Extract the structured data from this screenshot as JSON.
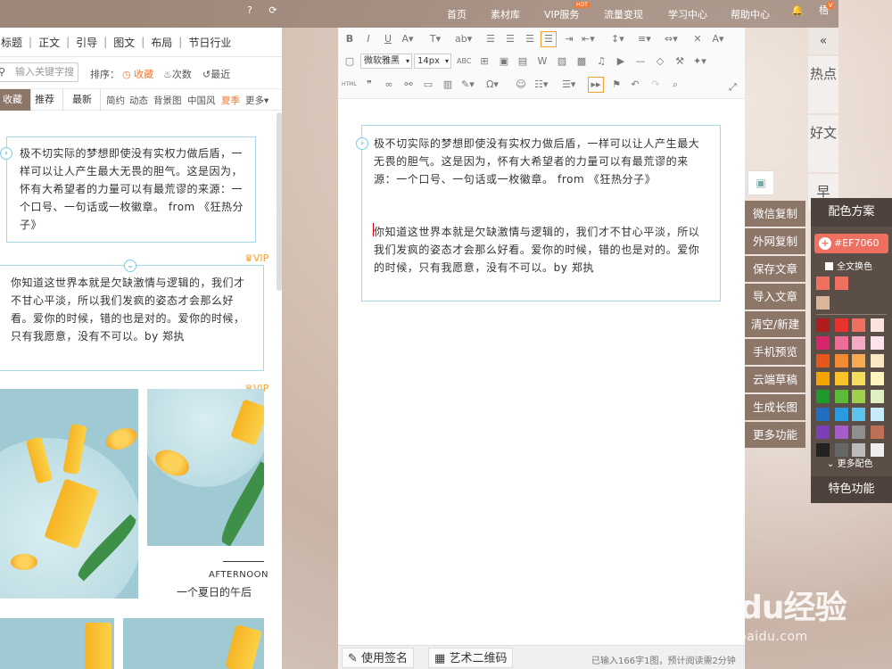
{
  "topnav": {
    "items": [
      "首页",
      "素材库",
      "VIP服务",
      "流量变现",
      "学习中心",
      "帮助中心"
    ],
    "hot_badge": "HOT",
    "user_label": "梧",
    "user_badge": "V"
  },
  "left": {
    "cat_tabs": [
      "标题",
      "正文",
      "引导",
      "图文",
      "布局",
      "节日行业"
    ],
    "search_placeholder": "输入关键字搜",
    "sort_label": "排序：",
    "sort_fav": "收藏",
    "sort_count": "次数",
    "sort_recent": "最近",
    "filter_tabs": [
      "收藏",
      "推荐",
      "最新"
    ],
    "filter_tags": [
      "简约",
      "动态",
      "背景图",
      "中国风",
      "夏季",
      "更多"
    ],
    "tpl1_text": "极不切实际的梦想即使没有实权力做后盾，一样可以让人产生最大无畏的胆气。这是因为，怀有大希望者的力量可以有最荒谬的来源：一个口号、一句话或一枚徽章。 from 《狂热分子》",
    "tpl2_text": "你知道这世界本就是欠缺激情与逻辑的，我们才不甘心平淡，所以我们发疯的姿态才会那么好看。爱你的时候，错的也是对的。爱你的时候，只有我愿意，没有不可以。by 郑执",
    "vip_label": "VIP",
    "photo_caption_en": "AFTERNOON",
    "photo_caption_cn": "一个夏日的午后"
  },
  "editor": {
    "font_family": "微软雅黑",
    "font_size": "14px",
    "para1": "极不切实际的梦想即使没有实权力做后盾，一样可以让人产生最大无畏的胆气。这是因为，怀有大希望者的力量可以有最荒谬的来源：一个口号、一句话或一枚徽章。 from 《狂热分子》",
    "para2": "你知道这世界本就是欠缺激情与逻辑的，我们才不甘心平淡，所以我们发疯的姿态才会那么好看。爱你的时候，错的也是对的。爱你的时候，只有我愿意，没有不可以。by 郑执",
    "sign_btn": "使用签名",
    "qr_btn": "艺术二维码",
    "word_count": "已输入166字1图，预计阅读需2分钟"
  },
  "actions": [
    "微信复制",
    "外网复制",
    "保存文章",
    "导入文章",
    "清空/新建",
    "手机预览",
    "云端草稿",
    "生成长图",
    "更多功能"
  ],
  "color_panel": {
    "title": "配色方案",
    "current": "#EF7060",
    "all_change": "全文换色",
    "more": "更多配色",
    "special": "特色功能",
    "recent": [
      "#ef7060",
      "#ef7060",
      "#ef7060",
      "#d9b59a"
    ],
    "grid": [
      [
        "#b01d1d",
        "#e8332e",
        "#ef7060",
        "#fbe4e0"
      ],
      [
        "#d8266b",
        "#ec6c9a",
        "#f5a9c6",
        "#fbe2ec"
      ],
      [
        "#e8561b",
        "#f28a34",
        "#f7aa52",
        "#fce7c4"
      ],
      [
        "#f5a400",
        "#f8c32a",
        "#f4dd5a",
        "#fff4c0"
      ],
      [
        "#1e9a2c",
        "#5cb93a",
        "#9ed04d",
        "#dff1c4"
      ],
      [
        "#1f6ec4",
        "#2b9ae0",
        "#5cc2ee",
        "#c7ebfa"
      ],
      [
        "#7a3fb6",
        "#a55ec8",
        "#8f8f8f",
        "#bf6f53"
      ],
      [
        "#222222",
        "#666666",
        "#bbbbbb",
        "#eeeeee"
      ]
    ]
  },
  "rail": {
    "items": [
      "热点",
      "好文",
      "早"
    ]
  },
  "watermark": {
    "logo": "Baidu经验",
    "url": "jingyan.baidu.com"
  }
}
